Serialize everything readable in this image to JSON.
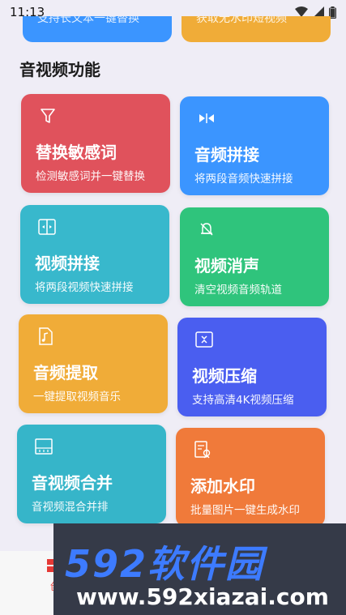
{
  "status_bar": {
    "time": "11:13"
  },
  "previous_cards": {
    "left_text": "支持长文本一键替换",
    "right_text": "获取无水印短视频"
  },
  "section": {
    "title": "音视频功能"
  },
  "cards": [
    {
      "title": "替换敏感词",
      "subtitle": "检测敏感词并一键替换",
      "icon": "filter-icon",
      "color": "#e0525c"
    },
    {
      "title": "音频拼接",
      "subtitle": "将两段音频快速拼接",
      "icon": "audio-merge-icon",
      "color": "#3b95ff"
    },
    {
      "title": "视频拼接",
      "subtitle": "将两段视频快速拼接",
      "icon": "video-merge-icon",
      "color": "#38b8cc"
    },
    {
      "title": "视频消声",
      "subtitle": "清空视频音频轨道",
      "icon": "mute-bell-icon",
      "color": "#2fc47c"
    },
    {
      "title": "音频提取",
      "subtitle": "一键提取视频音乐",
      "icon": "music-file-icon",
      "color": "#f0ac38"
    },
    {
      "title": "视频压缩",
      "subtitle": "支持高清4K视频压缩",
      "icon": "compress-icon",
      "color": "#4a5ef0"
    },
    {
      "title": "音视频合并",
      "subtitle": "音视频混合并排",
      "icon": "audio-video-merge-icon",
      "color": "#36b5c9"
    },
    {
      "title": "添加水印",
      "subtitle": "批量图片一键生成水印",
      "icon": "watermark-icon",
      "color": "#f07a3a"
    }
  ],
  "bottom_nav": {
    "active_label": "创"
  },
  "watermark": {
    "brand": "592软件园",
    "url": "www.592xiazai.com"
  }
}
